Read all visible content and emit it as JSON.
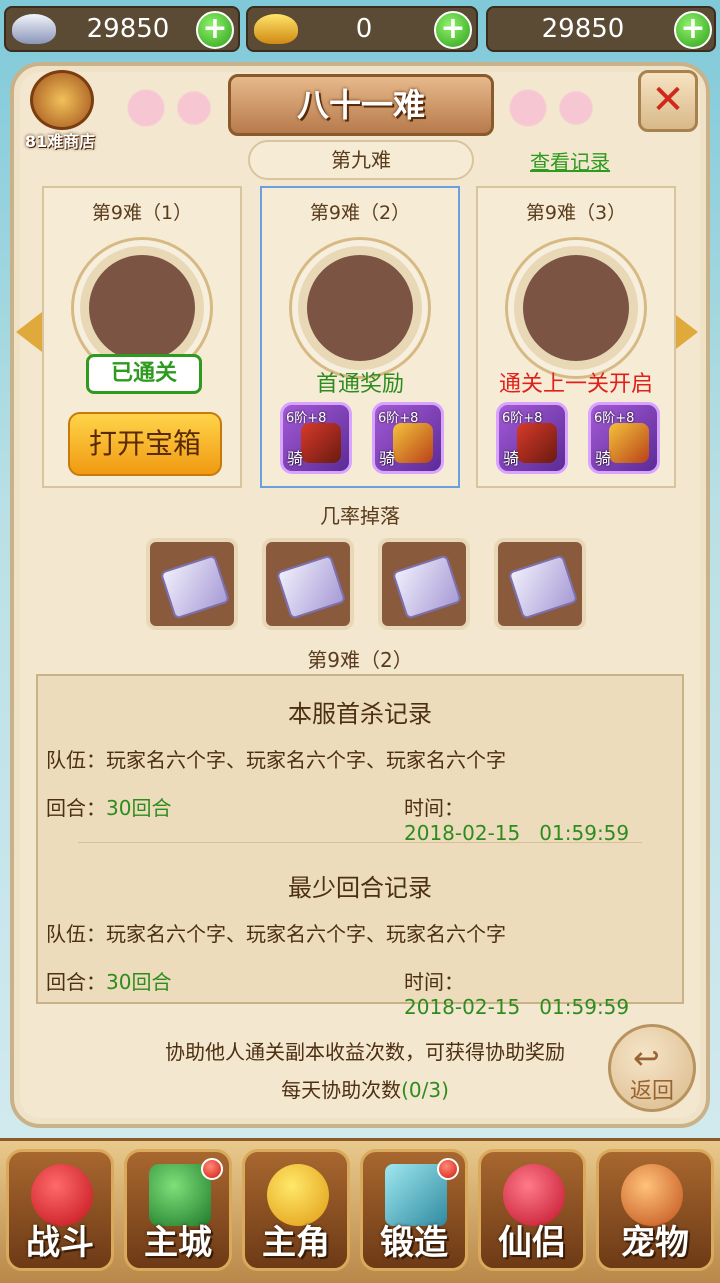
{
  "currency": {
    "silver": "29850",
    "gold": "0",
    "third": "29850"
  },
  "shop_label": "81难商店",
  "title": "八十一难",
  "stage_name": "第九难",
  "view_records": "查看记录",
  "cards": [
    {
      "title": "第9难（1）",
      "status": "已通关",
      "button": "打开宝箱"
    },
    {
      "title": "第9难（2）",
      "status": "首通奖励",
      "items": [
        {
          "level": "6阶+8",
          "type": "骑"
        },
        {
          "level": "6阶+8",
          "type": "骑"
        }
      ]
    },
    {
      "title": "第9难（3）",
      "status": "通关上一关开启",
      "items": [
        {
          "level": "6阶+8",
          "type": "骑"
        },
        {
          "level": "6阶+8",
          "type": "骑"
        }
      ]
    }
  ],
  "drop_title": "几率掉落",
  "selected_stage": "第9难（2）",
  "records": {
    "first_kill_title": "本服首杀记录",
    "first_team": "队伍：玩家名六个字、玩家名六个字、玩家名六个字",
    "first_rounds_label": "回合：",
    "first_rounds": "30回合",
    "first_time_label": "时间：",
    "first_time": "2018-02-15   01:59:59",
    "min_round_title": "最少回合记录",
    "min_team": "队伍：玩家名六个字、玩家名六个字、玩家名六个字",
    "min_rounds_label": "回合：",
    "min_rounds": "30回合",
    "min_time_label": "时间：",
    "min_time": "2018-02-15   01:59:59"
  },
  "assist_text": "协助他人通关副本收益次数，可获得协助奖励",
  "assist_count_label": "每天协助次数",
  "assist_count": "(0/3)",
  "back_label": "返回",
  "nav": [
    "战斗",
    "主城",
    "主角",
    "锻造",
    "仙侣",
    "宠物"
  ]
}
